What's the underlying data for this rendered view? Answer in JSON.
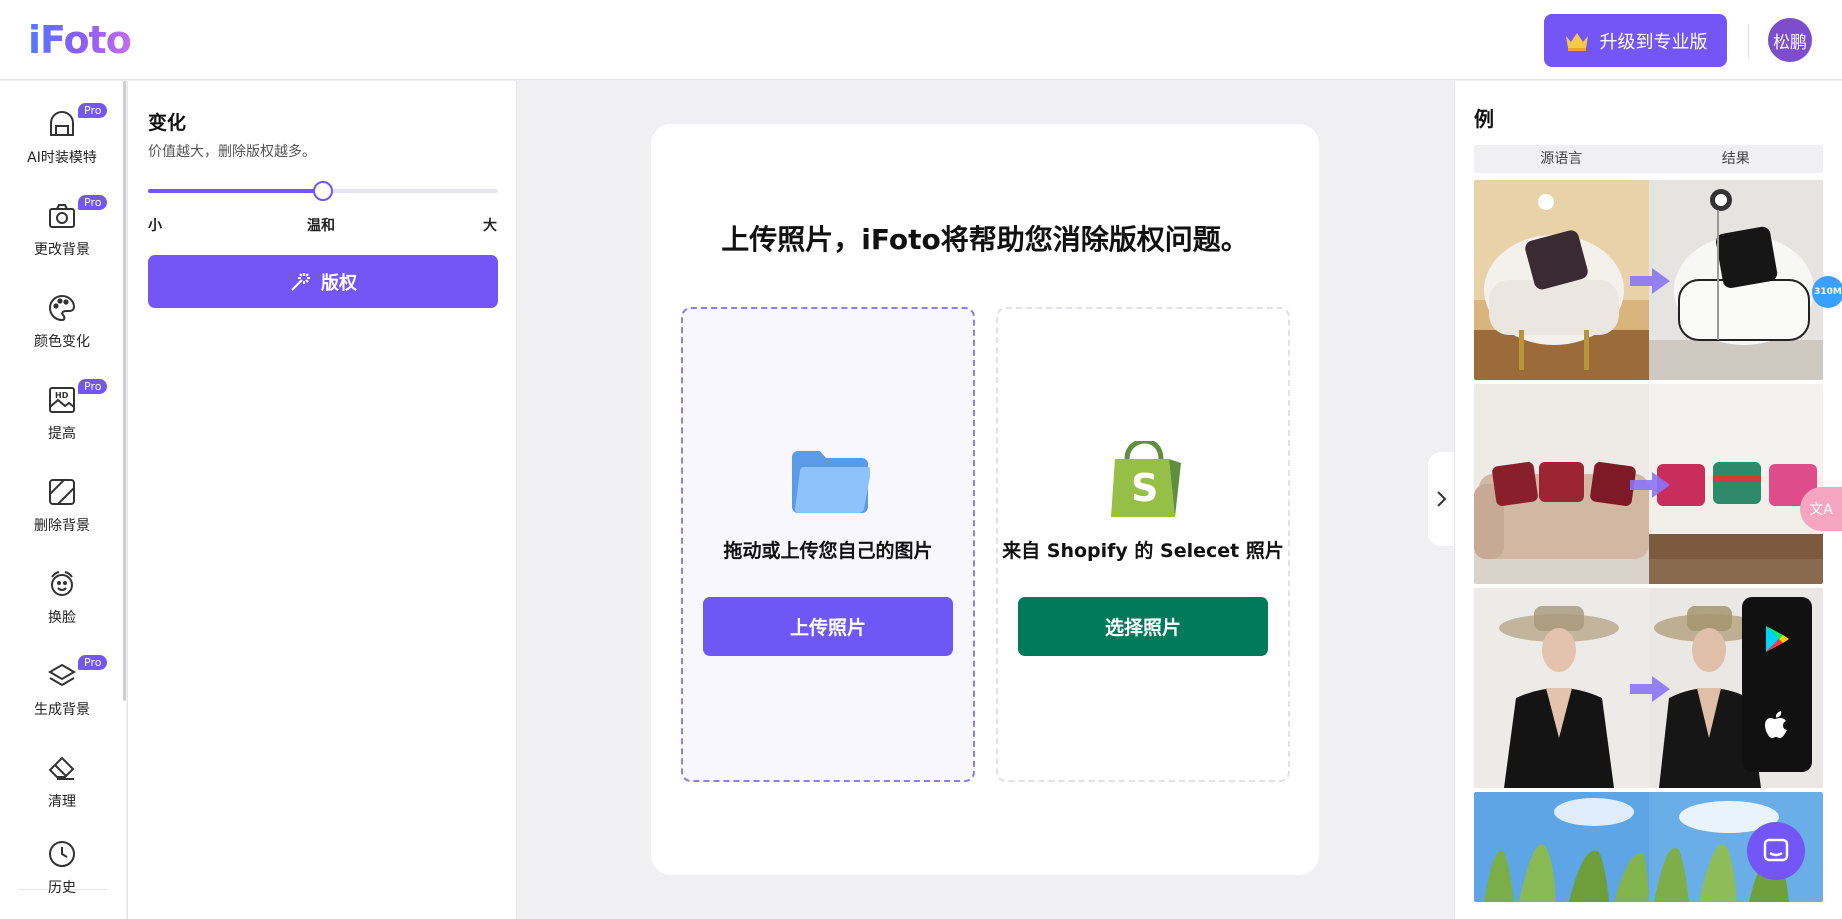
{
  "header": {
    "logo": "iFoto",
    "upgrade_label": "升级到专业版",
    "avatar_text": "松鹏"
  },
  "rail": {
    "items": [
      {
        "label": "AI时装模特",
        "pro": "Pro",
        "icon": "model-icon"
      },
      {
        "label": "更改背景",
        "pro": "Pro",
        "icon": "camera-icon"
      },
      {
        "label": "颜色变化",
        "pro": "",
        "icon": "palette-icon"
      },
      {
        "label": "提高",
        "pro": "Pro",
        "icon": "hd-image-icon"
      },
      {
        "label": "删除背景",
        "pro": "",
        "icon": "erase-background-icon"
      },
      {
        "label": "换脸",
        "pro": "",
        "icon": "face-swap-icon"
      },
      {
        "label": "生成背景",
        "pro": "Pro",
        "icon": "layers-icon"
      },
      {
        "label": "清理",
        "pro": "",
        "icon": "eraser-icon"
      }
    ],
    "history_label": "历史"
  },
  "panel": {
    "title": "变化",
    "subtitle": "价值越大，删除版权越多。",
    "slider_value": 0.5,
    "tick_small": "小",
    "tick_mid": "温和",
    "tick_large": "大",
    "apply_label": "版权"
  },
  "main": {
    "title": "上传照片，iFoto将帮助您消除版权问题。",
    "local_label": "拖动或上传您自己的图片",
    "local_button": "上传照片",
    "shopify_label": "来自 Shopify 的 Selecet 照片",
    "shopify_button": "选择照片"
  },
  "examples": {
    "title": "例",
    "tab_source": "源语言",
    "tab_result": "结果"
  },
  "floating": {
    "badge": "310M",
    "translate": "文A"
  },
  "colors": {
    "accent": "#7356f5",
    "shopify_green": "#007a5a"
  }
}
